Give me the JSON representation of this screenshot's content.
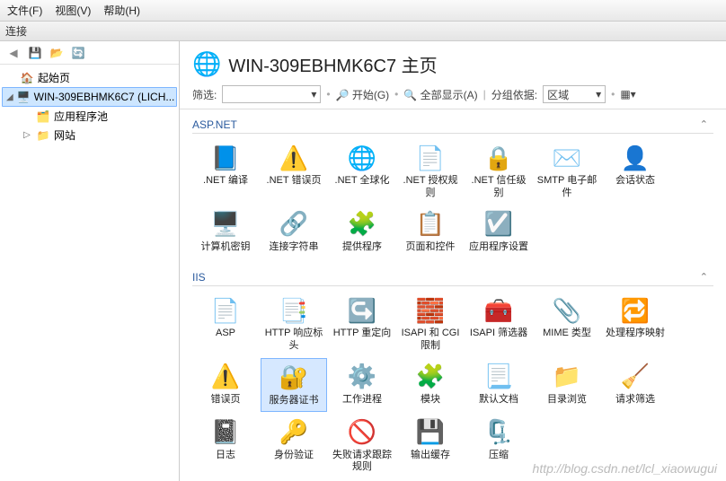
{
  "menu": {
    "file": "文件(F)",
    "view": "视图(V)",
    "help": "帮助(H)"
  },
  "sidebar": {
    "header": "连接",
    "items": [
      {
        "label": "起始页",
        "icon": "🏠",
        "indent": 0,
        "exp": ""
      },
      {
        "label": "WIN-309EBHMK6C7 (LICH...",
        "icon": "🖥️",
        "indent": 0,
        "exp": "◢",
        "selected": true
      },
      {
        "label": "应用程序池",
        "icon": "🗂️",
        "indent": 1,
        "exp": ""
      },
      {
        "label": "网站",
        "icon": "📁",
        "indent": 1,
        "exp": "▷"
      }
    ]
  },
  "page": {
    "title": "WIN-309EBHMK6C7 主页",
    "filterLabel": "筛选:",
    "goLabel": "开始(G)",
    "showAllLabel": "全部显示(A)",
    "groupByLabel": "分组依据:",
    "groupByValue": "区域"
  },
  "groups": [
    {
      "name": "ASP.NET",
      "items": [
        {
          "label": ".NET 编译",
          "icon": "📘"
        },
        {
          "label": ".NET 错误页",
          "icon": "⚠️"
        },
        {
          "label": ".NET 全球化",
          "icon": "🌐"
        },
        {
          "label": ".NET 授权规则",
          "icon": "📄"
        },
        {
          "label": ".NET 信任级别",
          "icon": "🔒"
        },
        {
          "label": "SMTP 电子邮件",
          "icon": "✉️"
        },
        {
          "label": "会话状态",
          "icon": "👤"
        },
        {
          "label": "计算机密钥",
          "icon": "🖥️"
        },
        {
          "label": "连接字符串",
          "icon": "🔗"
        },
        {
          "label": "提供程序",
          "icon": "🧩"
        },
        {
          "label": "页面和控件",
          "icon": "📋"
        },
        {
          "label": "应用程序设置",
          "icon": "☑️"
        }
      ]
    },
    {
      "name": "IIS",
      "items": [
        {
          "label": "ASP",
          "icon": "📄"
        },
        {
          "label": "HTTP 响应标头",
          "icon": "📑"
        },
        {
          "label": "HTTP 重定向",
          "icon": "↪️"
        },
        {
          "label": "ISAPI 和 CGI 限制",
          "icon": "🧱"
        },
        {
          "label": "ISAPI 筛选器",
          "icon": "🧰"
        },
        {
          "label": "MIME 类型",
          "icon": "📎"
        },
        {
          "label": "处理程序映射",
          "icon": "🔁"
        },
        {
          "label": "错误页",
          "icon": "⚠️"
        },
        {
          "label": "服务器证书",
          "icon": "🔐",
          "selected": true
        },
        {
          "label": "工作进程",
          "icon": "⚙️"
        },
        {
          "label": "模块",
          "icon": "🧩"
        },
        {
          "label": "默认文档",
          "icon": "📃"
        },
        {
          "label": "目录浏览",
          "icon": "📁"
        },
        {
          "label": "请求筛选",
          "icon": "🧹"
        },
        {
          "label": "日志",
          "icon": "📓"
        },
        {
          "label": "身份验证",
          "icon": "🔑"
        },
        {
          "label": "失败请求跟踪规则",
          "icon": "🚫"
        },
        {
          "label": "输出缓存",
          "icon": "💾"
        },
        {
          "label": "压缩",
          "icon": "🗜️"
        }
      ]
    }
  ],
  "watermark": "http://blog.csdn.net/lcl_xiaowugui"
}
